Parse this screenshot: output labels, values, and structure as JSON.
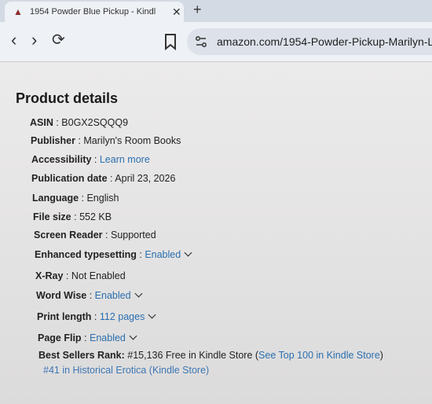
{
  "browser": {
    "tab_title": "1954 Powder Blue Pickup - Kindl",
    "tab_close": "✕",
    "new_tab": "+",
    "url": "amazon.com/1954-Powder-Pickup-Marilyn-Le"
  },
  "product": {
    "heading": "Product details",
    "details": [
      {
        "label": "ASIN",
        "value": "B0GX2SQQQ9"
      },
      {
        "label": "Publisher",
        "value": "Marilyn's Room Books"
      },
      {
        "label": "Accessibility",
        "value": "Learn more"
      },
      {
        "label": "Publication date",
        "value": "April 23, 2026"
      },
      {
        "label": "Language",
        "value": "English"
      },
      {
        "label": "File size",
        "value": "552 KB"
      },
      {
        "label": "Screen Reader",
        "value": "Supported"
      },
      {
        "label": "Enhanced typesetting",
        "value": "Enabled"
      },
      {
        "label": "X-Ray",
        "value": "Not Enabled"
      },
      {
        "label": "Word Wise",
        "value": "Enabled"
      },
      {
        "label": "Print length",
        "value": "112 pages"
      },
      {
        "label": "Page Flip",
        "value": "Enabled"
      }
    ],
    "best_sellers": {
      "label": "Best Sellers Rank:",
      "text": "#15,136 Free in Kindle Store (",
      "link": "See Top 100 in Kindle Store",
      "close": ")",
      "sub_rank": "#41 in Historical Erotica (Kindle Store)"
    }
  }
}
